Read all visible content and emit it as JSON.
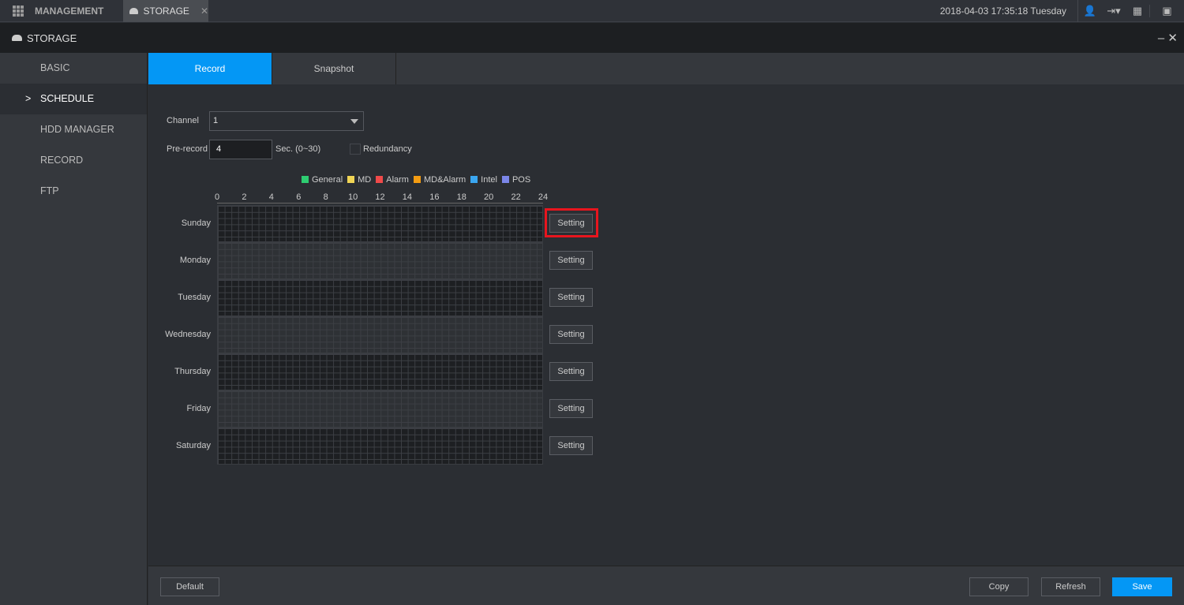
{
  "topbar": {
    "tabs": [
      {
        "label": "MANAGEMENT"
      },
      {
        "label": "STORAGE"
      }
    ],
    "datetime": "2018-04-03 17:35:18 Tuesday"
  },
  "title": "STORAGE",
  "sidebar": {
    "items": [
      {
        "label": "BASIC"
      },
      {
        "label": "SCHEDULE"
      },
      {
        "label": "HDD MANAGER"
      },
      {
        "label": "RECORD"
      },
      {
        "label": "FTP"
      }
    ]
  },
  "tabs": [
    {
      "label": "Record"
    },
    {
      "label": "Snapshot"
    }
  ],
  "form": {
    "channel_label": "Channel",
    "channel_value": "1",
    "prerecord_label": "Pre-record",
    "prerecord_value": "4",
    "prerecord_unit": "Sec. (0~30)",
    "redundancy_label": "Redundancy"
  },
  "legend": [
    {
      "label": "General",
      "color": "#2ecc71"
    },
    {
      "label": "MD",
      "color": "#f0d455"
    },
    {
      "label": "Alarm",
      "color": "#f04a4a"
    },
    {
      "label": "MD&Alarm",
      "color": "#f39c12"
    },
    {
      "label": "Intel",
      "color": "#3aa6f0"
    },
    {
      "label": "POS",
      "color": "#7b86e8"
    }
  ],
  "hours": [
    "0",
    "2",
    "4",
    "6",
    "8",
    "10",
    "12",
    "14",
    "16",
    "18",
    "20",
    "22",
    "24"
  ],
  "days": [
    "Sunday",
    "Monday",
    "Tuesday",
    "Wednesday",
    "Thursday",
    "Friday",
    "Saturday"
  ],
  "setting_label": "Setting",
  "footer": {
    "default": "Default",
    "copy": "Copy",
    "refresh": "Refresh",
    "save": "Save"
  }
}
